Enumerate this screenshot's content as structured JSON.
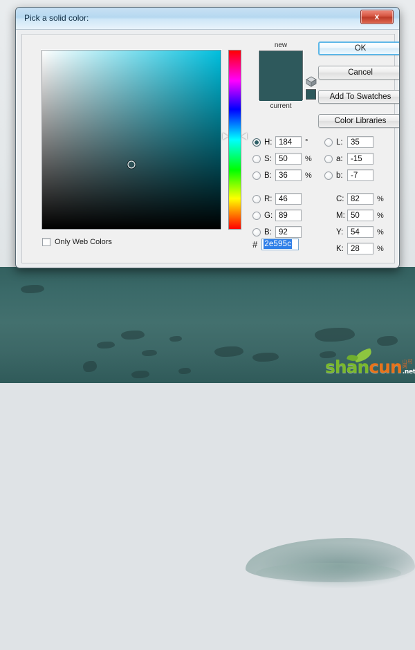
{
  "window": {
    "title": "Pick a solid color:",
    "close_label": "x"
  },
  "preview": {
    "new_label": "new",
    "current_label": "current",
    "new_color": "#2e595c",
    "current_color": "#2e595c",
    "alt_swatch_color": "#2e595c",
    "gamut_icon": "cube-icon"
  },
  "buttons": {
    "ok": "OK",
    "cancel": "Cancel",
    "add_to_swatches": "Add To Swatches",
    "color_libraries": "Color Libraries"
  },
  "only_web_colors": {
    "label": "Only Web Colors",
    "checked": false
  },
  "field": {
    "hue_color": "#00bfde",
    "marker_x_pct": 50,
    "marker_y_pct": 64,
    "hue_slider_pos_pct": 48
  },
  "values": {
    "hsb": [
      {
        "key": "H",
        "label": "H:",
        "value": "184",
        "unit": "°",
        "selected": true
      },
      {
        "key": "S",
        "label": "S:",
        "value": "50",
        "unit": "%",
        "selected": false
      },
      {
        "key": "B",
        "label": "B:",
        "value": "36",
        "unit": "%",
        "selected": false
      }
    ],
    "rgb": [
      {
        "key": "R",
        "label": "R:",
        "value": "46",
        "unit": "",
        "selected": false
      },
      {
        "key": "G",
        "label": "G:",
        "value": "89",
        "unit": "",
        "selected": false
      },
      {
        "key": "B",
        "label": "B:",
        "value": "92",
        "unit": "",
        "selected": false
      }
    ],
    "lab": [
      {
        "key": "L",
        "label": "L:",
        "value": "35",
        "unit": "",
        "selected": false
      },
      {
        "key": "a",
        "label": "a:",
        "value": "-15",
        "unit": "",
        "selected": false
      },
      {
        "key": "b",
        "label": "b:",
        "value": "-7",
        "unit": "",
        "selected": false
      }
    ],
    "cmyk": [
      {
        "key": "C",
        "label": "C:",
        "value": "82",
        "unit": "%"
      },
      {
        "key": "M",
        "label": "M:",
        "value": "50",
        "unit": "%"
      },
      {
        "key": "Y",
        "label": "Y:",
        "value": "54",
        "unit": "%"
      },
      {
        "key": "K",
        "label": "K:",
        "value": "28",
        "unit": "%"
      }
    ],
    "hex": {
      "hash": "#",
      "value": "2e595c",
      "selected": true
    }
  },
  "watermark": {
    "part1": "shan",
    "part2": "cun",
    "cn_text": "山村网",
    "net_text": ".net"
  }
}
